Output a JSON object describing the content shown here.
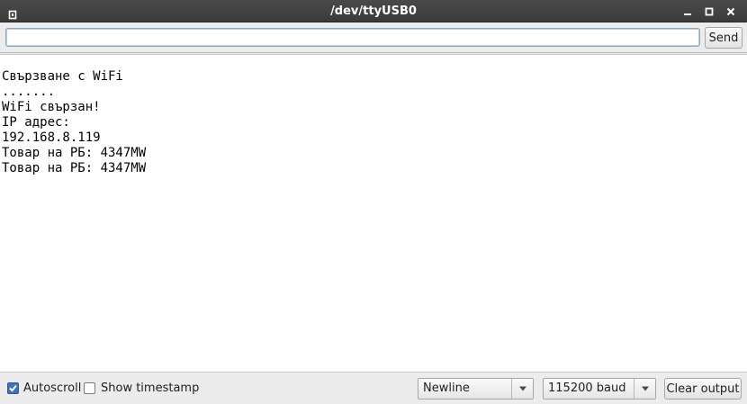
{
  "window": {
    "title": "/dev/ttyUSB0",
    "icons": {
      "app": "app-icon",
      "minimize": "minimize-icon",
      "maximize": "maximize-icon",
      "close": "close-icon"
    }
  },
  "input_row": {
    "input_value": "",
    "send_label": "Send"
  },
  "output": {
    "lines": [
      "Свързване с WiFi",
      ".......",
      "WiFi свързан!",
      "IP адрес:",
      "192.168.8.119",
      "Товар на РБ: 4347MW",
      "Товар на РБ: 4347MW"
    ]
  },
  "bottom_bar": {
    "autoscroll": {
      "label": "Autoscroll",
      "checked": true
    },
    "show_timestamp": {
      "label": "Show timestamp",
      "checked": false
    },
    "line_ending": {
      "selected": "Newline"
    },
    "baud_rate": {
      "selected": "115200 baud"
    },
    "clear_label": "Clear output"
  },
  "colors": {
    "titlebar": "#3f3f3f",
    "checkbox_checked": "#3f70b8",
    "input_focus_border": "#8ba6c4"
  }
}
